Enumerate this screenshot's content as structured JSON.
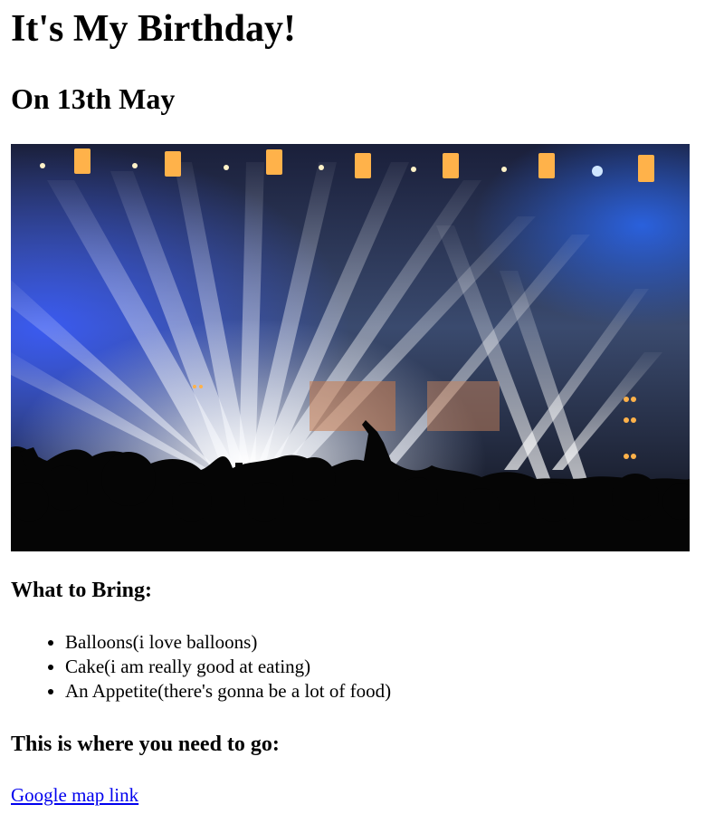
{
  "page": {
    "title": "It's My Birthday!",
    "date_heading": "On 13th May",
    "image": {
      "icon": "concert-stage-lights-photo"
    },
    "bring": {
      "heading": "What to Bring:",
      "items": [
        "Balloons(i love balloons)",
        "Cake(i am really good at eating)",
        "An Appetite(there's gonna be a lot of food)"
      ]
    },
    "location": {
      "heading": "This is where you need to go:",
      "link_label": "Google map link"
    }
  },
  "colors": {
    "link": "#0000ee",
    "text": "#000000",
    "background": "#ffffff"
  }
}
